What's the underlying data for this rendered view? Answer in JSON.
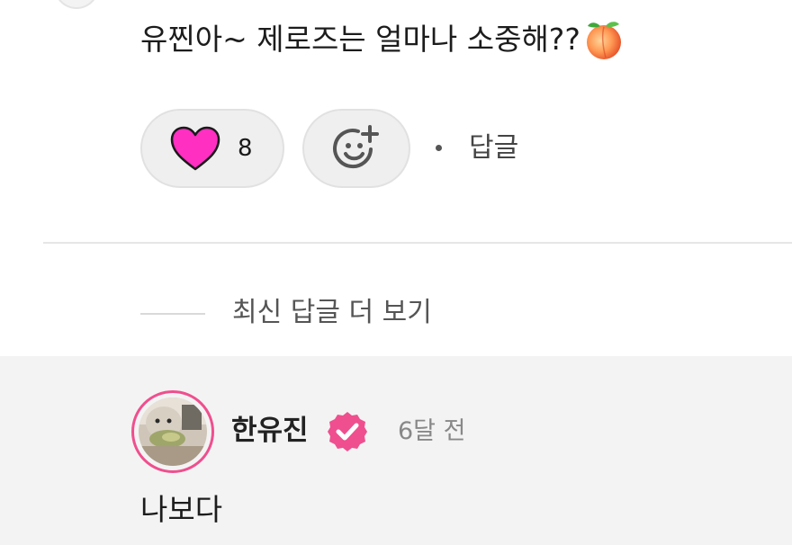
{
  "comment": {
    "text": "유찐아~ 제로즈는 얼마나 소중해??",
    "emoji": "peach-icon",
    "like_count": "8",
    "reply_label": "답글"
  },
  "replies_section": {
    "more_label": "최신 답글 더 보기"
  },
  "reply": {
    "author": "한유진",
    "time": "6달 전",
    "text": "나보다"
  },
  "colors": {
    "heart_fill": "#ff2fc2",
    "accent_pink": "#ef4f8e",
    "pill_bg": "#efefef",
    "reply_bg": "#f3f3f3"
  }
}
